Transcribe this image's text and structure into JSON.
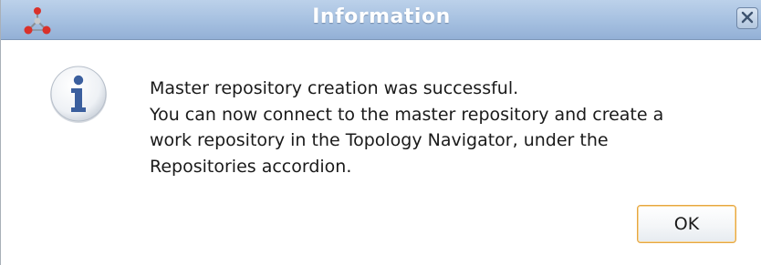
{
  "window": {
    "title": "Information",
    "app_icon": "odi-molecule-icon",
    "close_icon": "close-icon"
  },
  "dialog": {
    "icon": "info-icon",
    "message_lines": [
      "Master repository creation was successful.",
      "You can now connect to the master repository and create a",
      "work repository in the Topology Navigator, under the",
      "Repositories accordion."
    ]
  },
  "buttons": {
    "ok_label": "OK"
  },
  "colors": {
    "titlebar": "#a9c3e2",
    "title_text": "#ffffff",
    "ok_border_focus": "#e6a640",
    "info_icon": "#3b5f9e"
  }
}
